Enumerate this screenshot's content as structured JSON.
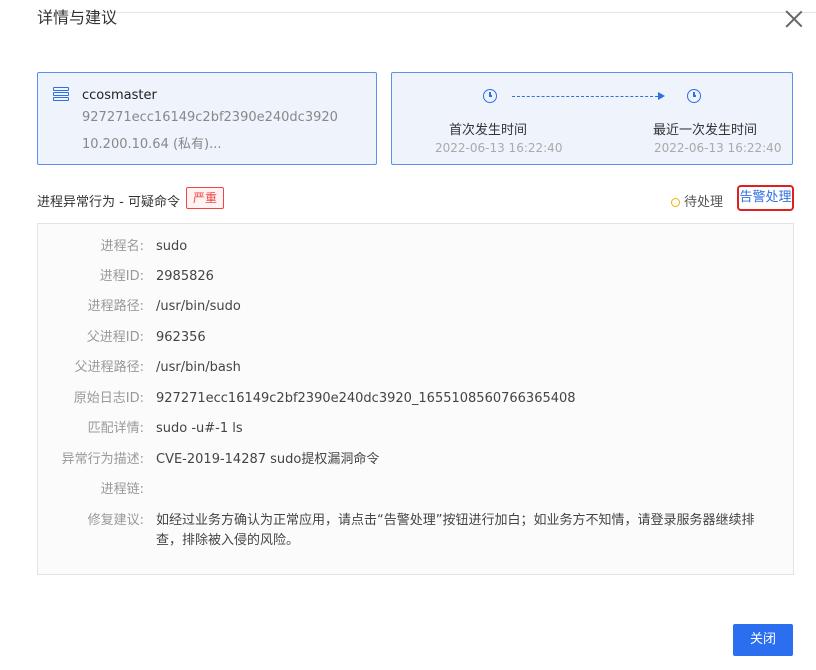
{
  "dialog": {
    "title": "详情与建议"
  },
  "host": {
    "name": "ccosmaster",
    "id": "927271ecc16149c2bf2390e240dc3920",
    "ip": "10.200.10.64 (私有)..."
  },
  "timeline": {
    "first_label": "首次发生时间",
    "first_time": "2022-06-13 16:22:40",
    "last_label": "最近一次发生时间",
    "last_time": "2022-06-13 16:22:40"
  },
  "section": {
    "title": "进程异常行为 - 可疑命令",
    "severity": "严重",
    "status": "待处理",
    "action": "告警处理"
  },
  "details": [
    {
      "key": "进程名:",
      "value": "sudo"
    },
    {
      "key": "进程ID:",
      "value": "2985826"
    },
    {
      "key": "进程路径:",
      "value": "/usr/bin/sudo"
    },
    {
      "key": "父进程ID:",
      "value": "962356"
    },
    {
      "key": "父进程路径:",
      "value": "/usr/bin/bash"
    },
    {
      "key": "原始日志ID:",
      "value": "927271ecc16149c2bf2390e240dc3920_1655108560766365408"
    },
    {
      "key": "匹配详情:",
      "value": "sudo -u#-1 ls"
    },
    {
      "key": "异常行为描述:",
      "value": "CVE-2019-14287 sudo提权漏洞命令"
    },
    {
      "key": "进程链:",
      "value": ""
    },
    {
      "key": "修复建议:",
      "value": "如经过业务方确认为正常应用，请点击“告警处理”按钮进行加白；如业务方不知情，请登录服务器继续排查，排除被入侵的风险。"
    }
  ],
  "footer": {
    "close_label": "关闭"
  },
  "colors": {
    "accent": "#2b6ff0",
    "danger": "#f04646",
    "pending": "#f0b400"
  },
  "icons": [
    "server-icon",
    "clock-icon",
    "close-icon",
    "pending-dot-icon"
  ]
}
